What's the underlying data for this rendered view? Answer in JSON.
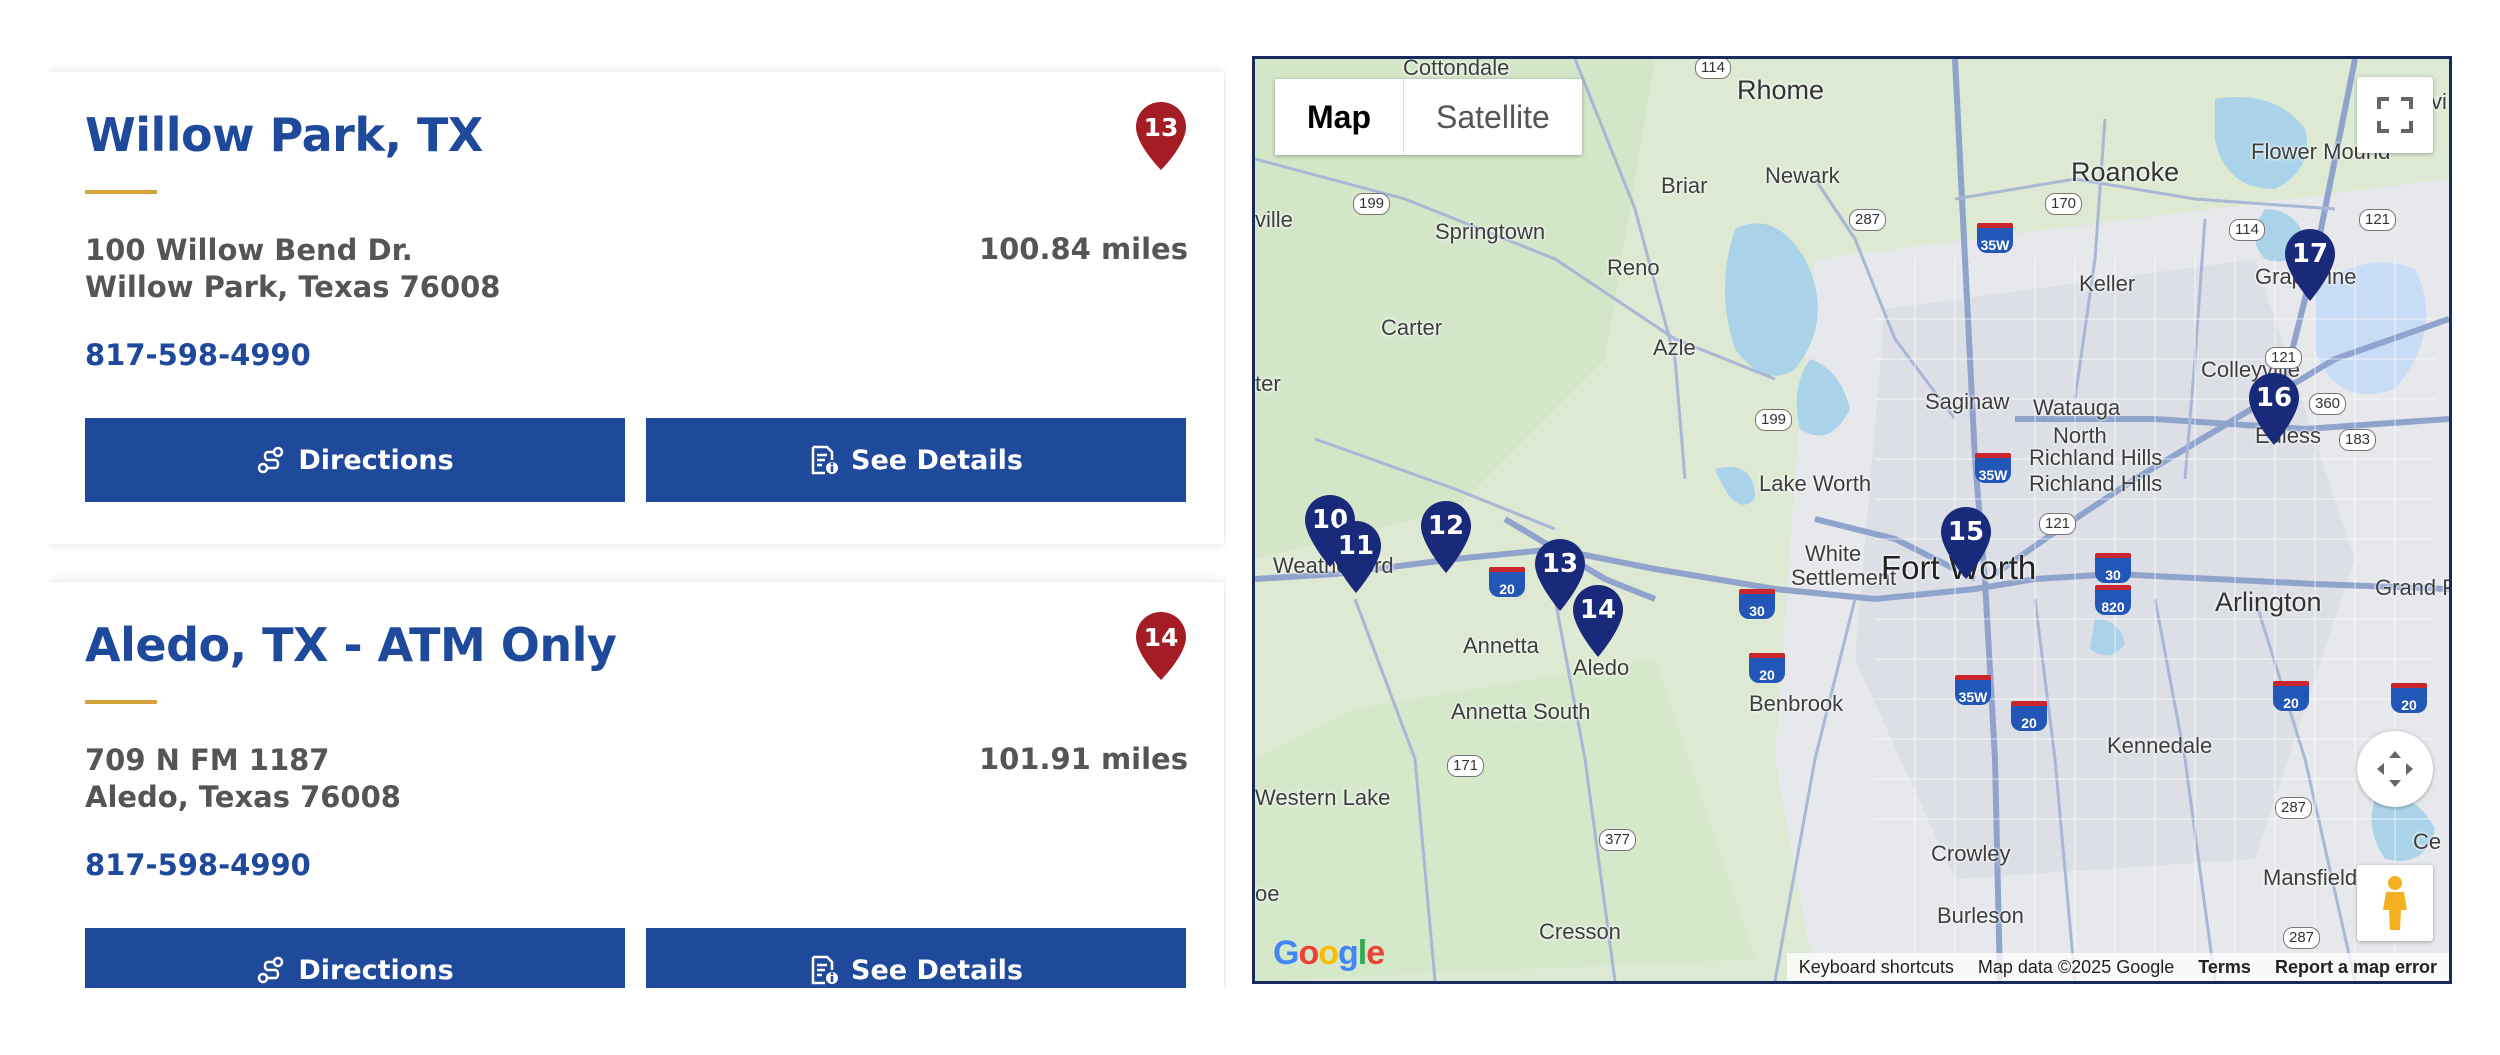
{
  "locations": [
    {
      "title": "Willow Park, TX",
      "marker": "13",
      "address_line1": "100 Willow Bend Dr.",
      "address_line2": "Willow Park, Texas 76008",
      "distance": "100.84 miles",
      "phone": "817-598-4990",
      "directions_label": "Directions",
      "details_label": "See Details"
    },
    {
      "title": "Aledo, TX - ATM Only",
      "marker": "14",
      "address_line1": "709 N FM 1187",
      "address_line2": "Aledo, Texas 76008",
      "distance": "101.91 miles",
      "phone": "817-598-4990",
      "directions_label": "Directions",
      "details_label": "See Details"
    }
  ],
  "colors": {
    "brand_blue": "#1f4a9c",
    "accent_gold": "#d6a33a",
    "selected_pin_red": "#a51d24",
    "map_pin_navy": "#1a2a7a"
  },
  "map": {
    "type_buttons": {
      "map": "Map",
      "satellite": "Satellite"
    },
    "places": {
      "cottondale": "Cottondale",
      "rhome": "Rhome",
      "newark": "Newark",
      "briar": "Briar",
      "roanoke": "Roanoke",
      "flower_mound": "Flower Mound",
      "springtown": "Springtown",
      "reno": "Reno",
      "keller": "Keller",
      "grapevine": "Grapevine",
      "carter": "Carter",
      "azle": "Azle",
      "colleyville": "Colleyville",
      "saginaw": "Saginaw",
      "watauga": "Watauga",
      "euless": "Euless",
      "north_richland_hills_1": "North",
      "north_richland_hills_2": "Richland Hills",
      "richland_hills": "Richland Hills",
      "lake_worth": "Lake Worth",
      "white_settlement_1": "White",
      "white_settlement_2": "Settlement",
      "weatherford": "Weatherford",
      "fort_worth": "Fort Worth",
      "arlington": "Arlington",
      "grand_prairie": "Grand Pra",
      "annetta": "Annetta",
      "aledo": "Aledo",
      "benbrook": "Benbrook",
      "annetta_south": "Annetta South",
      "kennedale": "Kennedale",
      "western_lake": "Western Lake",
      "crowley": "Crowley",
      "mansfield": "Mansfield",
      "burleson": "Burleson",
      "cresson": "Cresson",
      "ville": "ville",
      "ter": "ter",
      "ce": "Ce",
      "oe": "oe",
      "vi": "vi"
    },
    "highways": [
      "114",
      "199",
      "287",
      "170",
      "114",
      "121",
      "199",
      "121",
      "360",
      "183",
      "171",
      "377",
      "287",
      "287",
      "121"
    ],
    "interstates": [
      "35W",
      "35W",
      "20",
      "30",
      "20",
      "30",
      "820",
      "35W",
      "20",
      "20",
      "20"
    ],
    "markers": [
      "10",
      "11",
      "12",
      "13",
      "14",
      "15",
      "16",
      "17"
    ],
    "footer": {
      "shortcuts": "Keyboard shortcuts",
      "data": "Map data ©2025 Google",
      "terms": "Terms",
      "report": "Report a map error"
    },
    "logo": "Google",
    "icons": [
      "fullscreen-icon",
      "camera-control-icon",
      "pegman-icon"
    ]
  }
}
